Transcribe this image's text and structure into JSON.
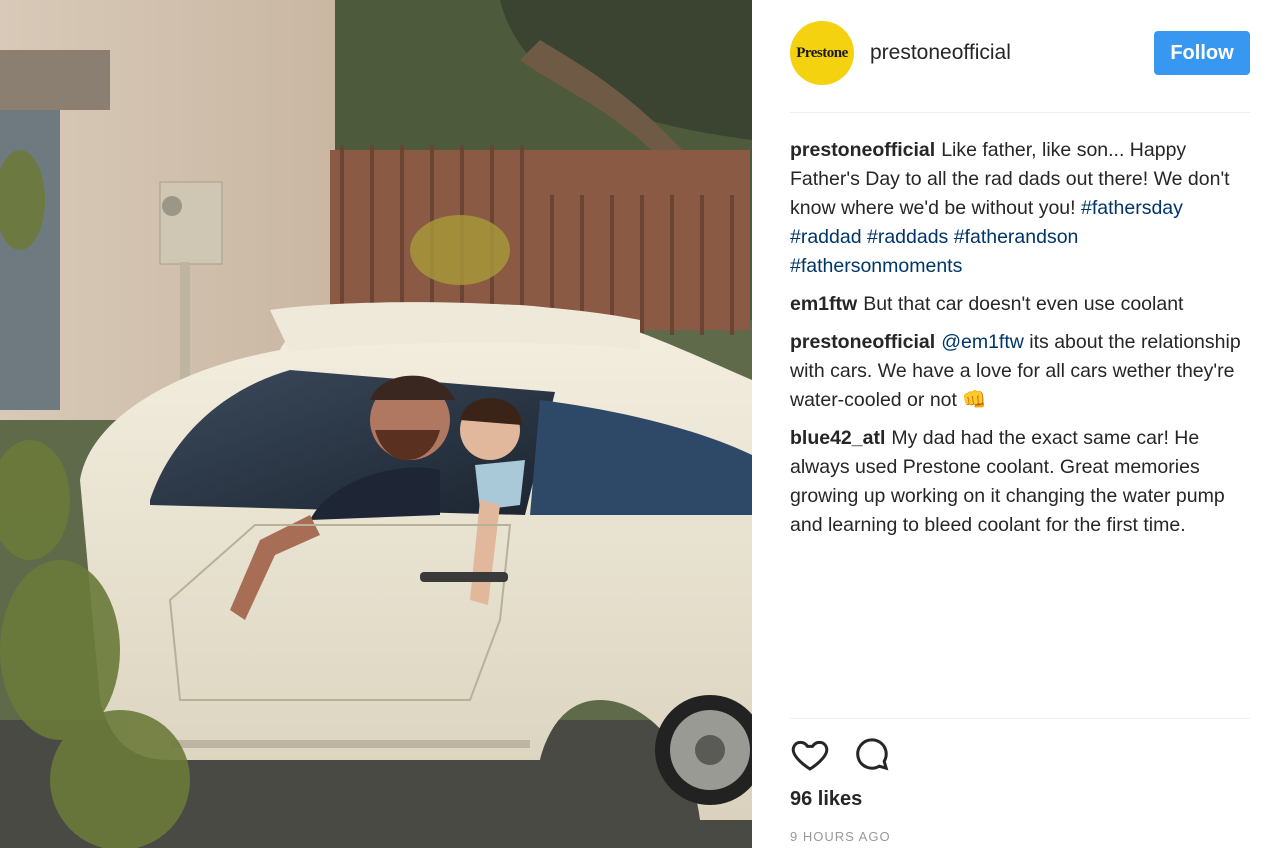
{
  "post": {
    "image_alt": "Father and son smiling from the window of a white vintage car",
    "icons": {
      "like": "heart-icon",
      "comment": "comment-bubble-icon"
    }
  },
  "author": {
    "username": "prestoneofficial",
    "avatar_text": "Prestone",
    "avatar_color": "#f5d20f"
  },
  "follow_label": "Follow",
  "accent_color": "#3897f0",
  "caption": {
    "user": "prestoneofficial",
    "text": "Like father, like son... Happy Father's Day to all the rad dads out there! We don't know where we'd be without you!",
    "hashtags": "#fathersday #raddad #raddads #fatherandson #fathersonmoments"
  },
  "comments": [
    {
      "user": "em1ftw",
      "text": "But that car doesn't even use coolant"
    },
    {
      "user": "prestoneofficial",
      "mention": "@em1ftw",
      "text": "its about the relationship with cars. We have a love for all cars wether they're water-cooled or not 👊"
    },
    {
      "user": "blue42_atl",
      "text": "My dad had the exact same car! He always used Prestone coolant. Great memories growing up working on it changing the water pump and learning to bleed coolant for the first time."
    }
  ],
  "likes_text": "96 likes",
  "timestamp": "9 HOURS AGO"
}
